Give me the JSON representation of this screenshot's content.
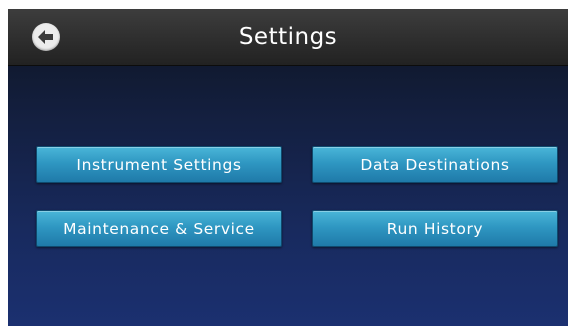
{
  "header": {
    "title": "Settings",
    "back_icon": "back-arrow-circle-icon"
  },
  "buttons": {
    "instrument_settings": "Instrument Settings",
    "data_destinations": "Data Destinations",
    "maintenance_service": "Maintenance & Service",
    "run_history": "Run History"
  },
  "colors": {
    "header_bg": "#2e2e2e",
    "screen_bg": "#182a5e",
    "button_bg": "#2f97c2",
    "text": "#ffffff"
  }
}
